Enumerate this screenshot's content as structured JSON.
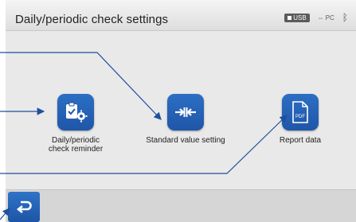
{
  "window": {
    "title": "Daily/periodic check settings"
  },
  "status": {
    "usb_label": "USB",
    "pc_label": "PC",
    "bluetooth_icon": "bluetooth-icon"
  },
  "menu": {
    "items": [
      {
        "label_line1": "Daily/periodic",
        "label_line2": "check reminder",
        "icon": "clipboard-gear-icon"
      },
      {
        "label_line1": "Standard value setting",
        "icon": "arrows-inward-icon"
      },
      {
        "label_line1": "Report data",
        "icon": "pdf-document-icon",
        "icon_text": "PDF"
      }
    ]
  },
  "footer": {
    "back_icon": "back-arrow-icon"
  },
  "colors": {
    "accent": "#1f56a8",
    "callout": "#1f4f9e"
  }
}
